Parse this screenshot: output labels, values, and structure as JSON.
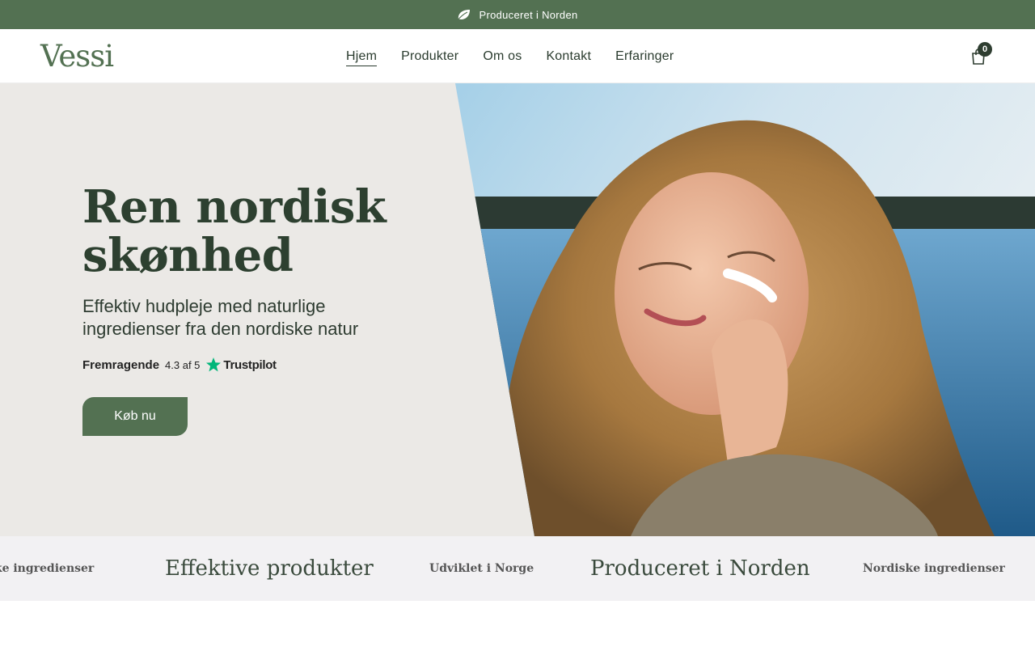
{
  "announcement": {
    "icon": "leaf-icon",
    "text": "Produceret i Norden"
  },
  "header": {
    "logo": "Vessi",
    "nav": [
      {
        "label": "Hjem",
        "active": true
      },
      {
        "label": "Produkter"
      },
      {
        "label": "Om os"
      },
      {
        "label": "Kontakt"
      },
      {
        "label": "Erfaringer"
      }
    ],
    "cart_count": "0"
  },
  "hero": {
    "title": "Ren nordisk skønhed",
    "subtitle": "Effektiv hudpleje med naturlige ingredienser fra den nordiske natur",
    "rating": {
      "label": "Fremragende",
      "score": "4.3 af 5",
      "brand": "Trustpilot"
    },
    "cta": "Køb nu",
    "image": "woman applying cream by a lake"
  },
  "marquee": {
    "items": [
      "ske ingredienser",
      "Effektive produkter",
      "Udviklet i Norge",
      "Produceret i Norden",
      "Nordiske ingredienser"
    ]
  },
  "colors": {
    "accent": "#537152",
    "hero_bg": "#ebe9e6",
    "trustpilot": "#00b67a"
  }
}
